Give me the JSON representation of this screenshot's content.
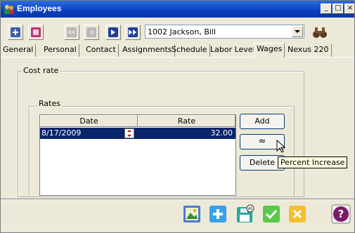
{
  "window": {
    "title": "Employees",
    "min_label": "_",
    "max_label": "□",
    "close_label": "×"
  },
  "toolbar": {
    "employee_selected": "1002 Jackson, Bill"
  },
  "tabs": [
    {
      "label": "General"
    },
    {
      "label": "Personal"
    },
    {
      "label": "Contact"
    },
    {
      "label": "Assignments"
    },
    {
      "label": "Schedule"
    },
    {
      "label": "Labor Level"
    },
    {
      "label": "Wages",
      "active": true
    },
    {
      "label": "Nexus 220"
    }
  ],
  "cost_rate": {
    "legend": "Cost rate",
    "rates_legend": "Rates",
    "columns": [
      "Date",
      "Rate"
    ],
    "rows": [
      {
        "date": "8/17/2009",
        "rate": "32.00"
      }
    ]
  },
  "buttons": {
    "add": "Add",
    "up_glyph": "≈",
    "delete": "Delete"
  },
  "tooltip": "Percent Increase",
  "colors": {
    "selection": "#0a246a",
    "titlebar": "#0a3fbf"
  }
}
